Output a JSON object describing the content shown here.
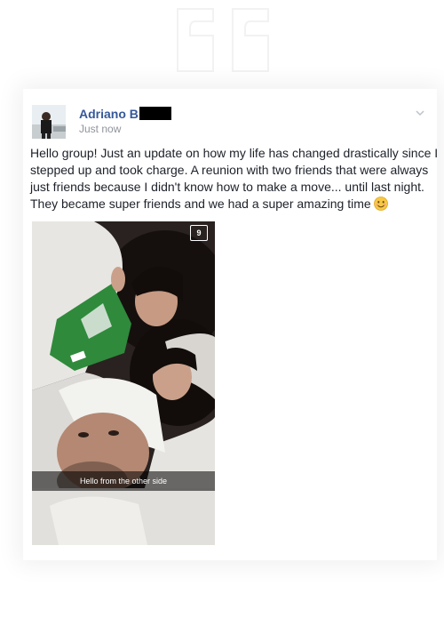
{
  "post": {
    "author": "Adriano B",
    "timestamp": "Just now",
    "body": "Hello group! Just an update on how my life has changed drastically since I stepped up and took charge. A reunion with two friends that were always just friends because I didn't know how to make a move... until last night. They became super friends and we had a super amazing time",
    "emoji": "smiling-face-emoji",
    "options_icon": "chevron-down-icon"
  },
  "photo": {
    "timer": "9",
    "caption": "Hello from the other side"
  },
  "colors": {
    "author_link": "#365899",
    "secondary_text": "#90949c",
    "body_text": "#1d2129"
  }
}
